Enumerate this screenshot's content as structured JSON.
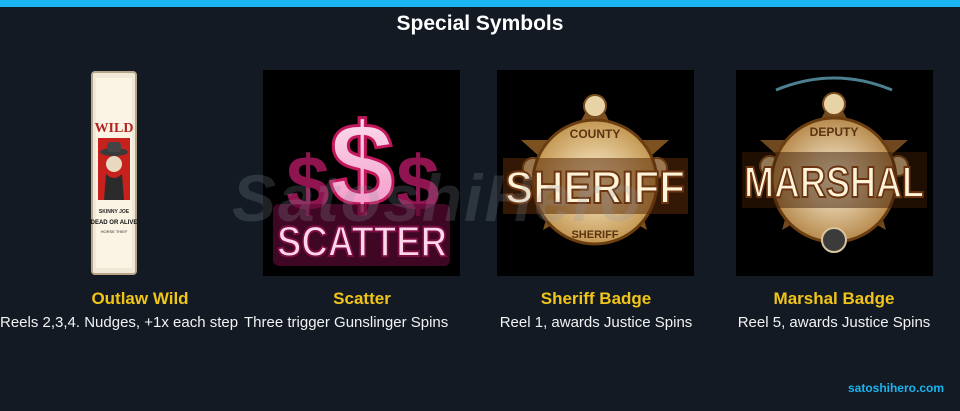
{
  "header": {
    "title": "Special Symbols"
  },
  "watermark": "SatoshiHero",
  "symbols": [
    {
      "name": "Outlaw Wild",
      "description": "Reels 2,3,4. Nudges, +1x each step",
      "poster": {
        "top": "WILD",
        "line1": "SKINNY JOE",
        "line2": "DEAD OR ALIVE",
        "line3": "HORSE THIEF"
      }
    },
    {
      "name": "Scatter",
      "description": "Three trigger Gunslinger Spins",
      "art_text": "SCATTER",
      "art_glyph": "$"
    },
    {
      "name": "Sheriff Badge",
      "description": "Reel 1, awards Justice Spins",
      "art_text": "SHERIFF",
      "ring_top": "COUNTY",
      "ring_bottom": "SHERIFF"
    },
    {
      "name": "Marshal Badge",
      "description": "Reel 5, awards Justice Spins",
      "art_text": "MARSHAL",
      "ring_top": "DEPUTY"
    }
  ],
  "footer": {
    "site": "satoshihero.com"
  },
  "colors": {
    "accent": "#1ab4f0",
    "name_gold": "#f0c419",
    "background": "#131a24"
  }
}
